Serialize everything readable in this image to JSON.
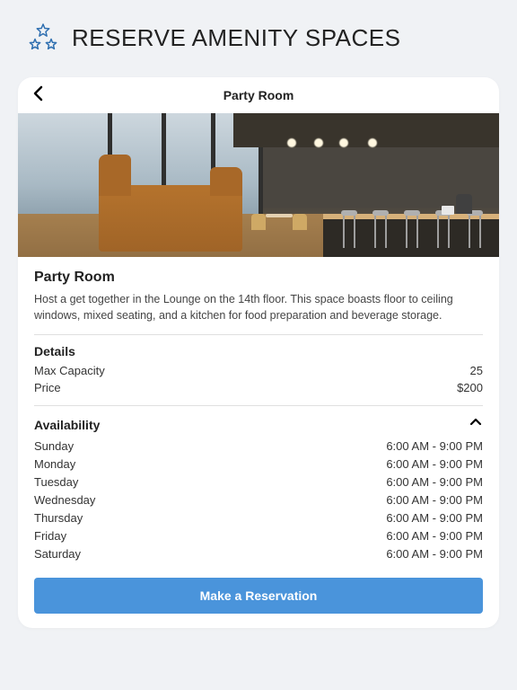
{
  "header": {
    "title": "RESERVE AMENITY SPACES"
  },
  "card": {
    "title": "Party Room",
    "room_name": "Party Room",
    "description": "Host a get together in the Lounge on the 14th floor. This space boasts floor to ceiling windows, mixed seating, and a kitchen for food preparation and beverage storage.",
    "details": {
      "heading": "Details",
      "capacity_label": "Max Capacity",
      "capacity_value": "25",
      "price_label": "Price",
      "price_value": "$200"
    },
    "availability": {
      "heading": "Availability",
      "days": [
        {
          "day": "Sunday",
          "hours": "6:00 AM - 9:00 PM"
        },
        {
          "day": "Monday",
          "hours": "6:00 AM - 9:00 PM"
        },
        {
          "day": "Tuesday",
          "hours": "6:00 AM - 9:00 PM"
        },
        {
          "day": "Wednesday",
          "hours": "6:00 AM - 9:00 PM"
        },
        {
          "day": "Thursday",
          "hours": "6:00 AM - 9:00 PM"
        },
        {
          "day": "Friday",
          "hours": "6:00 AM - 9:00 PM"
        },
        {
          "day": "Saturday",
          "hours": "6:00 AM - 9:00 PM"
        }
      ]
    },
    "reserve_label": "Make a Reservation"
  },
  "colors": {
    "accent": "#4a94db",
    "icon_stroke": "#2f6fb0"
  }
}
